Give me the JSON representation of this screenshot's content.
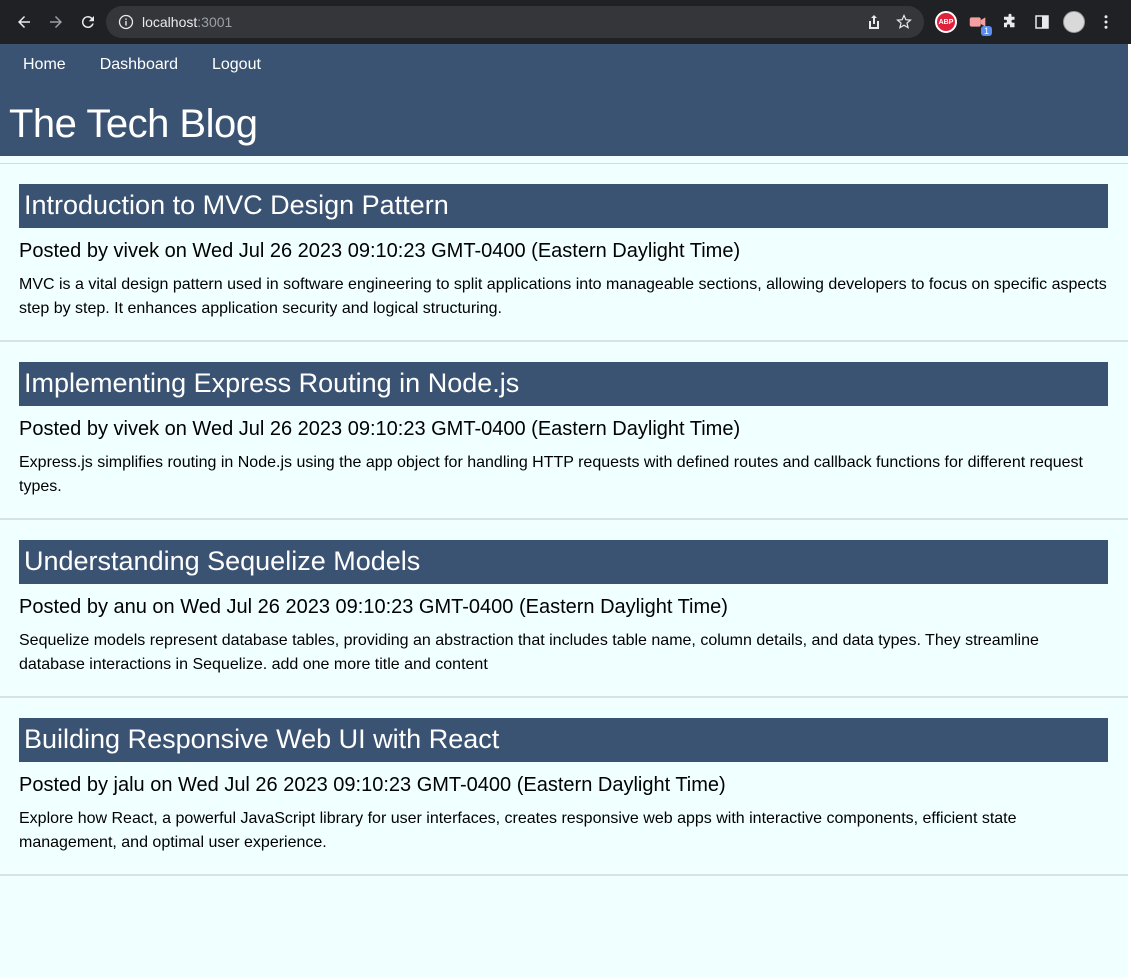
{
  "browser": {
    "url_host": "localhost",
    "url_port": ":3001",
    "extension_badge": "1",
    "abp_label": "ABP"
  },
  "site": {
    "nav": [
      "Home",
      "Dashboard",
      "Logout"
    ],
    "title": "The Tech Blog"
  },
  "posts": [
    {
      "title": "Introduction to MVC Design Pattern",
      "meta": "Posted by vivek on Wed Jul 26 2023 09:10:23 GMT-0400 (Eastern Daylight Time)",
      "body": "MVC is a vital design pattern used in software engineering to split applications into manageable sections, allowing developers to focus on specific aspects step by step. It enhances application security and logical structuring."
    },
    {
      "title": "Implementing Express Routing in Node.js",
      "meta": "Posted by vivek on Wed Jul 26 2023 09:10:23 GMT-0400 (Eastern Daylight Time)",
      "body": "Express.js simplifies routing in Node.js using the app object for handling HTTP requests with defined routes and callback functions for different request types."
    },
    {
      "title": "Understanding Sequelize Models",
      "meta": "Posted by anu on Wed Jul 26 2023 09:10:23 GMT-0400 (Eastern Daylight Time)",
      "body": "Sequelize models represent database tables, providing an abstraction that includes table name, column details, and data types. They streamline database interactions in Sequelize. add one more title and content"
    },
    {
      "title": "Building Responsive Web UI with React",
      "meta": "Posted by jalu on Wed Jul 26 2023 09:10:23 GMT-0400 (Eastern Daylight Time)",
      "body": "Explore how React, a powerful JavaScript library for user interfaces, creates responsive web apps with interactive components, efficient state management, and optimal user experience."
    }
  ],
  "colors": {
    "header_bg": "#3b5373",
    "page_bg": "#f0ffff",
    "chrome_bg": "#202124"
  }
}
